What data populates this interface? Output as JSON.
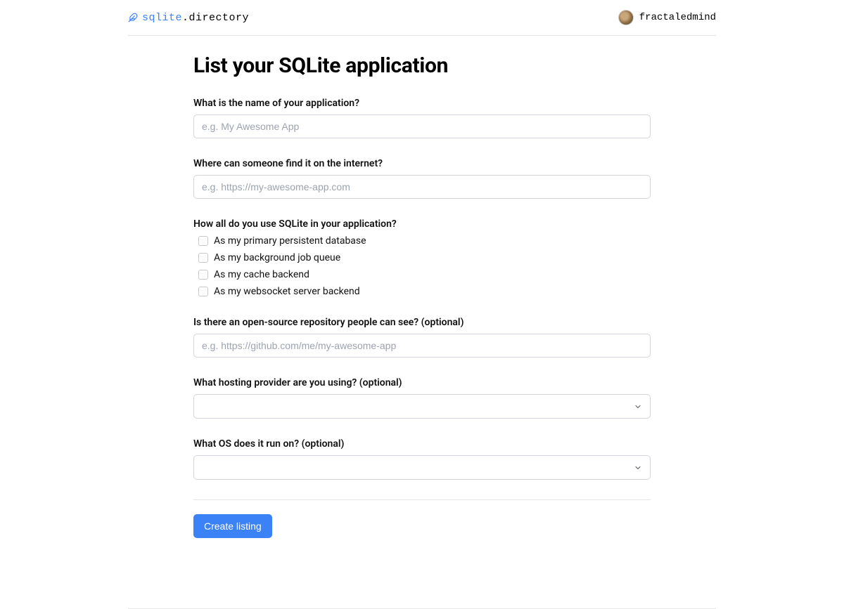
{
  "header": {
    "logo_prefix": "sqlite",
    "logo_suffix": ".directory",
    "username": "fractaledmind"
  },
  "form": {
    "title": "List your SQLite application",
    "fields": {
      "name": {
        "label": "What is the name of your application?",
        "placeholder": "e.g. My Awesome App",
        "value": ""
      },
      "url": {
        "label": "Where can someone find it on the internet?",
        "placeholder": "e.g. https://my-awesome-app.com",
        "value": ""
      },
      "usage": {
        "label": "How all do you use SQLite in your application?",
        "options": [
          "As my primary persistent database",
          "As my background job queue",
          "As my cache backend",
          "As my websocket server backend"
        ]
      },
      "repo": {
        "label": "Is there an open-source repository people can see? (optional)",
        "placeholder": "e.g. https://github.com/me/my-awesome-app",
        "value": ""
      },
      "hosting": {
        "label": "What hosting provider are you using? (optional)",
        "value": ""
      },
      "os": {
        "label": "What OS does it run on? (optional)",
        "value": ""
      }
    },
    "submit_label": "Create listing"
  }
}
